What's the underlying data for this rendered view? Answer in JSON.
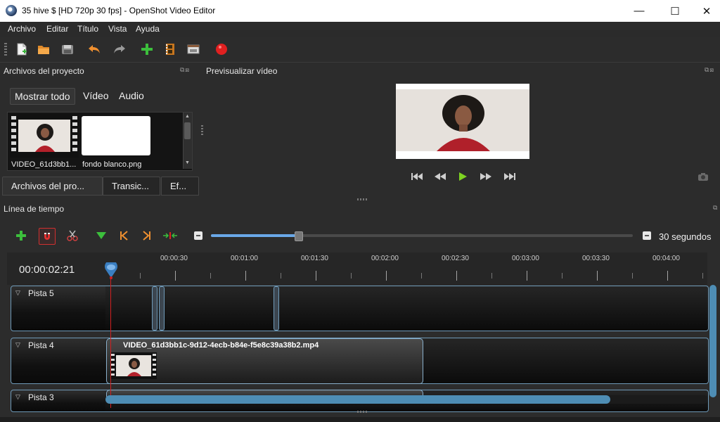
{
  "window": {
    "title": "35 hive $ [HD 720p 30 fps] - OpenShot Video Editor",
    "minimize": "—",
    "maximize": "☐",
    "close": "✕"
  },
  "menu": [
    "Archivo",
    "Editar",
    "Título",
    "Vista",
    "Ayuda"
  ],
  "toolbar": {
    "icons": [
      "new-project-icon",
      "open-project-icon",
      "save-project-icon",
      "undo-icon",
      "redo-icon",
      "import-files-icon",
      "profile-icon",
      "fullscreen-icon",
      "export-record-icon"
    ]
  },
  "project_files": {
    "title": "Archivos del proyecto",
    "filter_tabs": [
      "Mostrar todo",
      "Vídeo",
      "Audio"
    ],
    "active_filter": "Mostrar todo",
    "files": [
      {
        "label": "VIDEO_61d3bb1..."
      },
      {
        "label": "fondo blanco.png"
      }
    ],
    "bottom_tabs": [
      "Archivos del pro...",
      "Transic...",
      "Ef..."
    ]
  },
  "preview": {
    "title": "Previsualizar vídeo",
    "controls": [
      "jump-start-icon",
      "rewind-icon",
      "play-icon",
      "fast-forward-icon",
      "jump-end-icon"
    ]
  },
  "timeline": {
    "title": "Línea de tiempo",
    "zoom_label": "30 segundos",
    "zoom_level": 0.2,
    "current_time": "00:00:02:21",
    "ruler_labels": [
      "00:00:30",
      "00:01:00",
      "00:01:30",
      "00:02:00",
      "00:02:30",
      "00:03:00",
      "00:03:30",
      "00:04:00"
    ],
    "tracks": [
      {
        "name": "Pista 5"
      },
      {
        "name": "Pista 4"
      },
      {
        "name": "Pista 3"
      }
    ],
    "clip_title": "VIDEO_61d3bb1c-9d12-4ecb-b84e-f5e8c39a38b2.mp4"
  },
  "colors": {
    "accent": "#4e8db4",
    "playhead": "#d02020",
    "record": "#e02020"
  }
}
